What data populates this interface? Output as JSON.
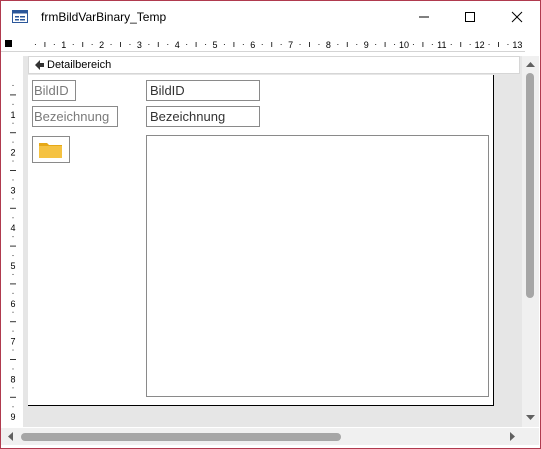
{
  "window": {
    "title": "frmBildVarBinary_Temp",
    "controls": {
      "minimize": "minimize-icon",
      "maximize": "maximize-icon",
      "close": "close-icon"
    }
  },
  "ruler": {
    "horizontal_numbers": [
      "1",
      "2",
      "3",
      "4",
      "5",
      "6",
      "7",
      "8",
      "9",
      "10",
      "11",
      "12",
      "13"
    ],
    "vertical_numbers": [
      "1",
      "2",
      "3",
      "4",
      "5",
      "6",
      "7",
      "8",
      "9"
    ]
  },
  "section": {
    "label": "Detailbereich"
  },
  "form": {
    "label_bildid": "BildID",
    "label_bezeichnung": "Bezeichnung",
    "field_bildid": "BildID",
    "field_bezeichnung": "Bezeichnung",
    "button_icon": "folder-icon"
  },
  "colors": {
    "frame": "#b03a4e",
    "folder": "#f5c242",
    "scroll_thumb": "#a6a6a6"
  }
}
